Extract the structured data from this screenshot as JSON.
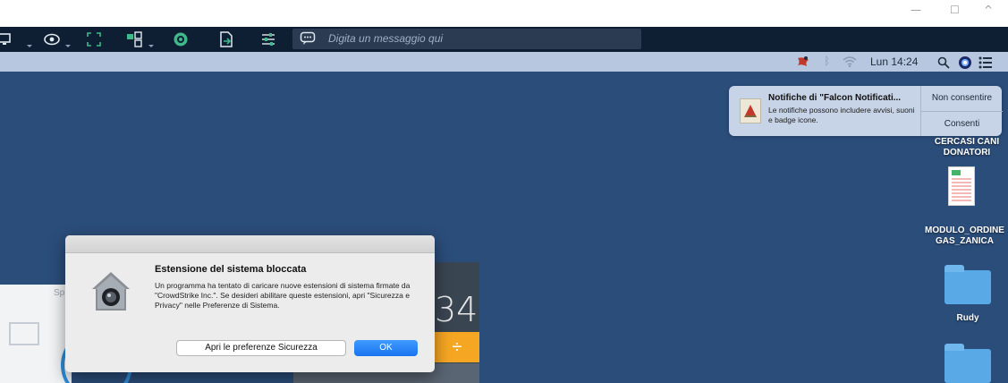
{
  "window": {
    "controls": {
      "minimize": "—",
      "maximize": "☐",
      "collapse": "^"
    }
  },
  "toolbar": {
    "message_placeholder": "Digita un messaggio qui",
    "icons": [
      "monitor-icon",
      "eye-icon",
      "expand-icon",
      "apps-icon",
      "record-icon",
      "file-transfer-icon",
      "settings-sliders-icon",
      "chat-icon"
    ]
  },
  "menubar": {
    "clock": "Lun 14:24",
    "icons": [
      "crowdstrike-icon",
      "bluetooth-icon",
      "wifi-icon",
      "search-icon",
      "siri-icon",
      "notification-center-icon"
    ]
  },
  "notification": {
    "title": "Notifiche di \"Falcon Notificati...",
    "body": "Le notifiche possono includere avvisi, suoni e badge icone.",
    "deny_label": "Non consentire",
    "allow_label": "Consenti"
  },
  "desktop": {
    "items": [
      {
        "label_line1": "CERCASI CANI",
        "label_line2": "DONATORI"
      },
      {
        "label_line1": "MODULO_ORDINE",
        "label_line2": "GAS_ZANICA"
      },
      {
        "label_line1": "Rudy",
        "label_line2": ""
      }
    ]
  },
  "background_apps": {
    "sp_fragment": "Sp",
    "calc_display": "34",
    "calc_operator": "÷"
  },
  "dialog": {
    "title": "Estensione del sistema bloccata",
    "message": "Un programma ha tentato di caricare nuove estensioni di sistema firmate da \"CrowdStrike Inc.\". Se desideri abilitare queste estensioni, apri \"Sicurezza e Privacy\" nelle Preferenze di Sistema.",
    "secondary_button": "Apri le preferenze Sicurezza",
    "primary_button": "OK"
  },
  "colors": {
    "toolbar_bg": "#0f1f33",
    "desktop_bg": "#2b4d7a",
    "menubar_bg": "#b7c7e0",
    "primary_button": "#1a74f0",
    "calc_operator": "#f5a623",
    "folder": "#58a9e6"
  }
}
